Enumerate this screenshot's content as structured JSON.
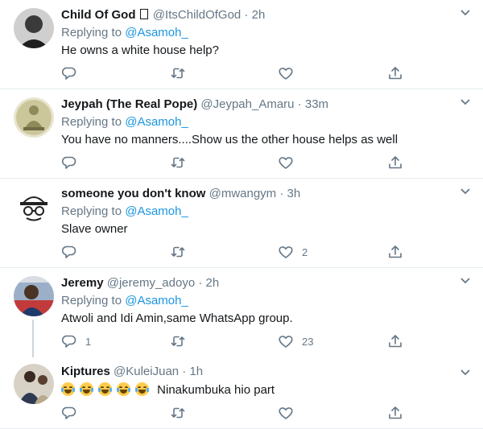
{
  "replying_label": "Replying to",
  "tweets": [
    {
      "name": "Child Of God",
      "handle": "@ItsChildOfGod",
      "time": "2h",
      "reply_to": "@Asamoh_",
      "text": "He owns a white house help?",
      "replies": "",
      "retweets": "",
      "likes": ""
    },
    {
      "name": "Jeypah (The Real Pope)",
      "handle": "@Jeypah_Amaru",
      "time": "33m",
      "reply_to": "@Asamoh_",
      "text": "You have no manners....Show us the other house helps as well",
      "replies": "",
      "retweets": "",
      "likes": ""
    },
    {
      "name": "someone you don't know",
      "handle": "@mwangym",
      "time": "3h",
      "reply_to": "@Asamoh_",
      "text": "Slave owner",
      "replies": "",
      "retweets": "",
      "likes": "2"
    },
    {
      "name": "Jeremy",
      "handle": "@jeremy_adoyo",
      "time": "2h",
      "reply_to": "@Asamoh_",
      "text": "Atwoli and Idi Amin,same WhatsApp group.",
      "replies": "1",
      "retweets": "",
      "likes": "23"
    },
    {
      "name": "Kiptures",
      "handle": "@KuleiJuan",
      "time": "1h",
      "reply_to": "",
      "text": "Ninakumbuka hio part",
      "emoji_count": 5,
      "replies": "",
      "retweets": "",
      "likes": ""
    }
  ],
  "colors": {
    "link": "#1b95e0",
    "muted": "#657786",
    "divider": "#e6ecf0",
    "thread_line": "#ccd6dd"
  },
  "icons": {
    "menu": "chevron-down-icon",
    "reply": "reply-icon",
    "retweet": "retweet-icon",
    "like": "heart-icon",
    "share": "share-icon",
    "emoji": "face-with-tears-of-joy-icon"
  }
}
